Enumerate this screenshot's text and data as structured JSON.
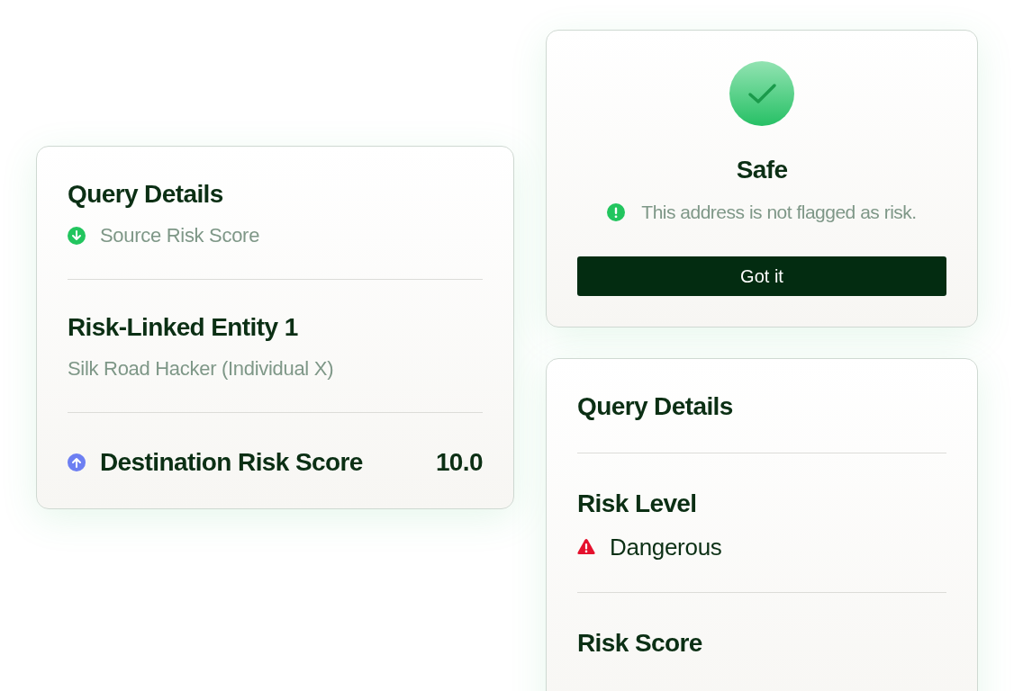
{
  "query_card": {
    "title": "Query Details",
    "source": "Source Risk Score",
    "entity": {
      "title": "Risk-Linked Entity 1",
      "name": "Silk Road Hacker (Individual X)"
    },
    "destination": {
      "label": "Destination Risk Score",
      "value": "10.0"
    }
  },
  "result_card": {
    "status": "Safe",
    "message": "This address is not flagged as risk.",
    "button": "Got it"
  },
  "details_card": {
    "title": "Query Details",
    "risk_level": {
      "label": "Risk Level",
      "value": "Dangerous"
    },
    "risk_score": {
      "label": "Risk Score"
    }
  }
}
